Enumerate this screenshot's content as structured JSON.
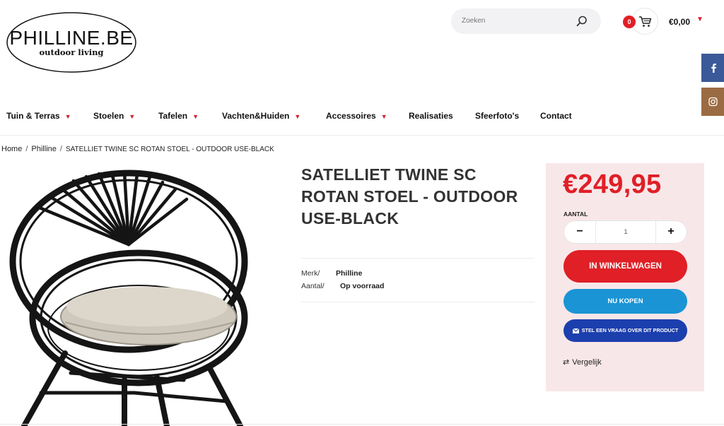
{
  "logo": {
    "main": "PHILLINE.BE",
    "sub": "outdoor living"
  },
  "search": {
    "placeholder": "Zoeken",
    "icon": "search-icon"
  },
  "cart": {
    "count": "0",
    "total": "€0,00",
    "icon": "cart-icon"
  },
  "social": [
    {
      "name": "facebook",
      "icon": "facebook-icon",
      "color": "#3b5998"
    },
    {
      "name": "instagram",
      "icon": "instagram-icon",
      "color": "#9b6b43"
    }
  ],
  "nav": {
    "items": [
      {
        "label": "Tuin & Terras",
        "has_dropdown": true
      },
      {
        "label": "Stoelen",
        "has_dropdown": true
      },
      {
        "label": "Tafelen",
        "has_dropdown": true
      },
      {
        "label": "Vachten&Huiden",
        "has_dropdown": true
      },
      {
        "label": "Accessoires",
        "has_dropdown": true
      },
      {
        "label": "Realisaties",
        "has_dropdown": false
      },
      {
        "label": "Sfeerfoto's",
        "has_dropdown": false
      },
      {
        "label": "Contact",
        "has_dropdown": false
      }
    ]
  },
  "breadcrumb": {
    "home": "Home",
    "brand": "Philline",
    "current": "SATELLIET TWINE SC ROTAN STOEL - OUTDOOR USE-BLACK"
  },
  "product": {
    "title": "SATELLIET TWINE SC ROTAN STOEL - OUTDOOR USE-BLACK",
    "meta": {
      "brand_label": "Merk/",
      "brand_value": "Philline",
      "stock_label": "Aantal/",
      "stock_value": "Op voorraad"
    }
  },
  "purchase": {
    "price": "€249,95",
    "qty_label": "AANTAL",
    "qty_value": "1",
    "minus": "−",
    "plus": "+",
    "add_to_cart": "IN WINKELWAGEN",
    "buy_now": "NU KOPEN",
    "ask_question": "STEL EEN VRAAG OVER DIT PRODUCT",
    "compare": "Vergelijk"
  },
  "colors": {
    "accent_red": "#e01f26",
    "buy_blue": "#1a94d5",
    "ask_navy": "#1c3fae",
    "panel_pink": "#f8e7e9"
  }
}
